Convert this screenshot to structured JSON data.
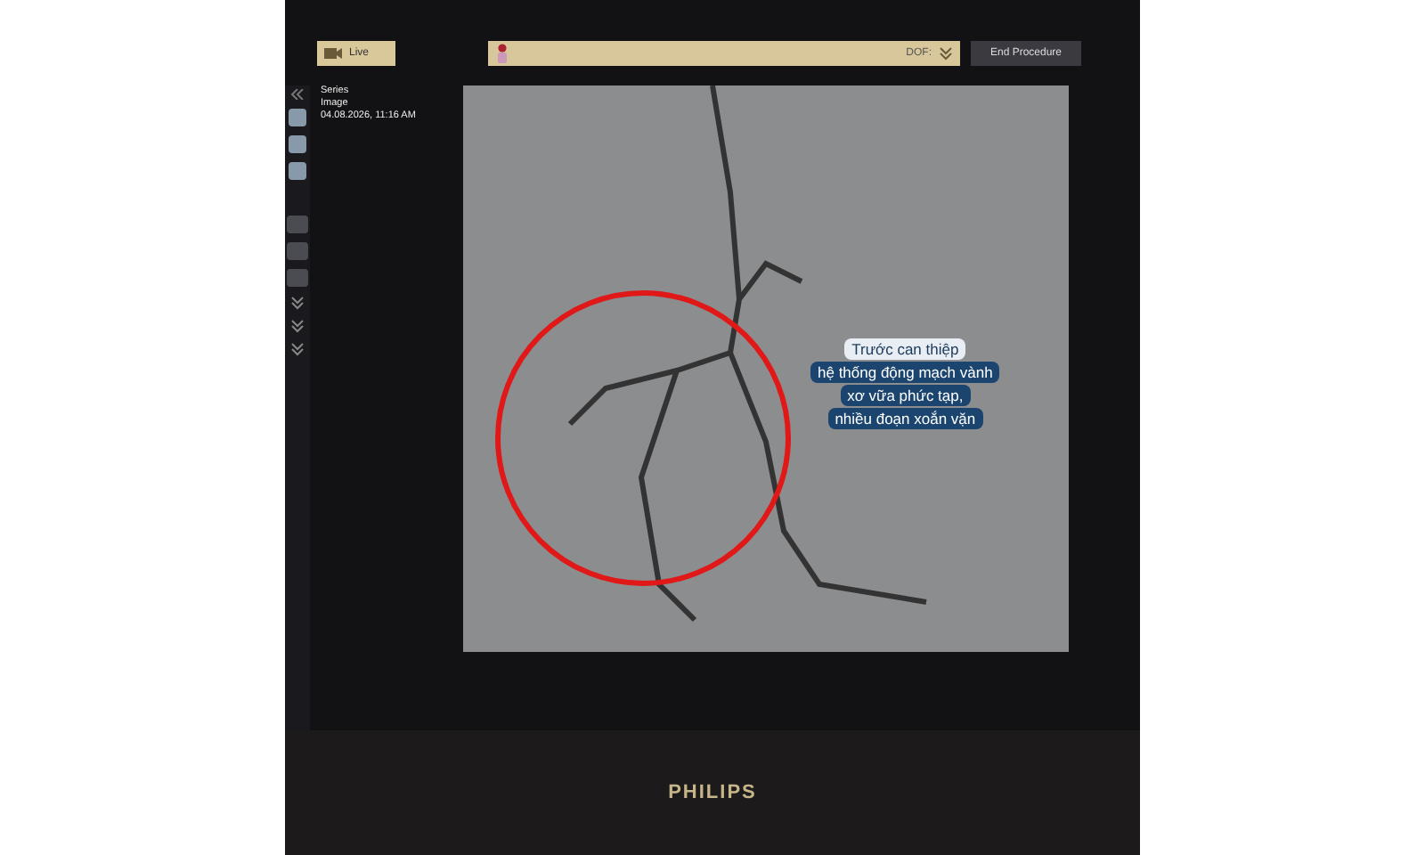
{
  "top_bar": {
    "live_tab": "Live",
    "dof_label": "DOF:",
    "end_button": "End Procedure"
  },
  "image_info": {
    "series": "Series",
    "image": "Image",
    "timestamp": "04.08.2026, 11:16 AM"
  },
  "annotation": [
    {
      "text": "Trước can thiệp",
      "kind": "heading"
    },
    {
      "text": "hệ thống động mạch vành",
      "kind": "body"
    },
    {
      "text": "xơ vữa phức tạp,",
      "kind": "body"
    },
    {
      "text": "nhiều đoạn xoắn vặn",
      "kind": "body"
    }
  ],
  "monitor_brand": "PHILIPS"
}
